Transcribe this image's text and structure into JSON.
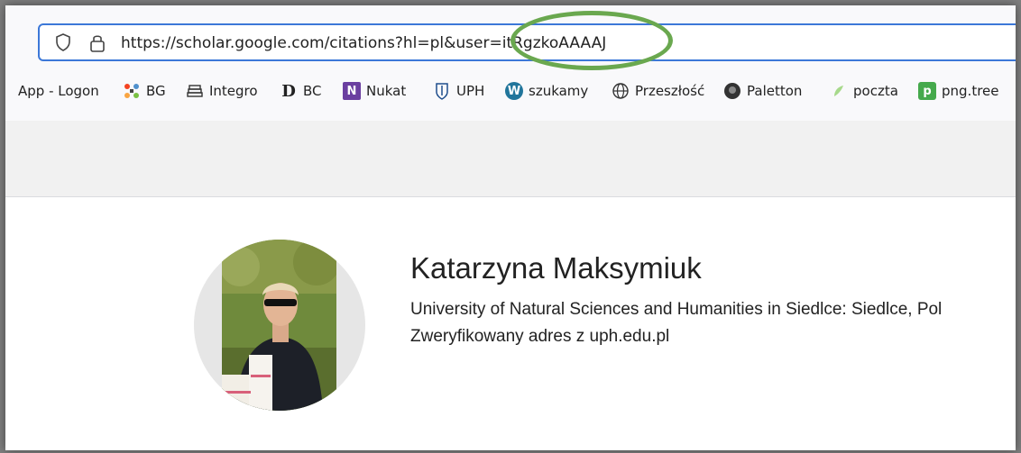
{
  "browser": {
    "url": "https://scholar.google.com/citations?hl=pl&user=itRgzkoAAAAJ",
    "accent_color": "#3c78d8",
    "highlight_color": "#6aa84f"
  },
  "bookmarks": [
    {
      "label": "App - Logon",
      "icon": "none"
    },
    {
      "label": "BG",
      "icon": "joomla-icon"
    },
    {
      "label": "Integro",
      "icon": "books-icon"
    },
    {
      "label": "BC",
      "icon": "d-logo-icon"
    },
    {
      "label": "Nukat",
      "icon": "nukat-icon"
    },
    {
      "label": "UPH",
      "icon": "uph-crest-icon"
    },
    {
      "label": "szukamy",
      "icon": "wordpress-icon"
    },
    {
      "label": "Przeszłość",
      "icon": "globe-icon"
    },
    {
      "label": "Paletton",
      "icon": "paletton-icon"
    },
    {
      "label": "poczta",
      "icon": "leaf-icon"
    },
    {
      "label": "png.tree",
      "icon": "pngtree-icon"
    }
  ],
  "profile": {
    "name": "Katarzyna Maksymiuk",
    "affiliation": "University of Natural Sciences and Humanities in Siedlce: Siedlce, Pol",
    "email_line": "Zweryfikowany adres z uph.edu.pl"
  }
}
